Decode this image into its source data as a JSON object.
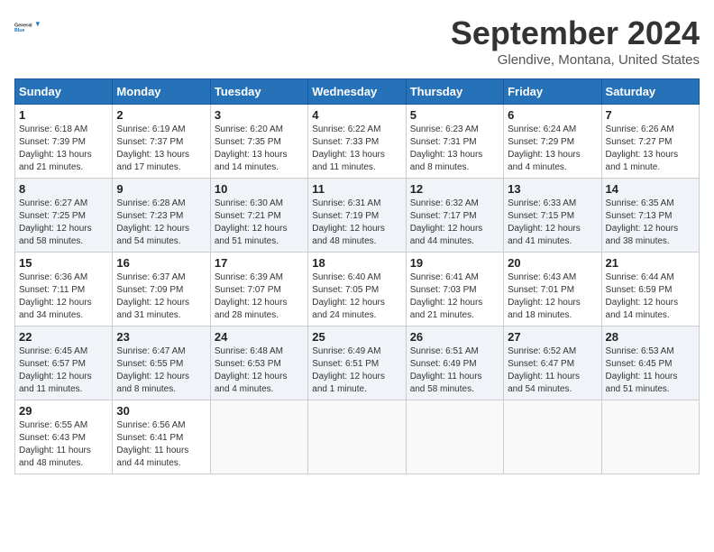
{
  "logo": {
    "line1": "General",
    "line2": "Blue"
  },
  "title": "September 2024",
  "subtitle": "Glendive, Montana, United States",
  "weekdays": [
    "Sunday",
    "Monday",
    "Tuesday",
    "Wednesday",
    "Thursday",
    "Friday",
    "Saturday"
  ],
  "weeks": [
    [
      {
        "day": "1",
        "info": "Sunrise: 6:18 AM\nSunset: 7:39 PM\nDaylight: 13 hours\nand 21 minutes."
      },
      {
        "day": "2",
        "info": "Sunrise: 6:19 AM\nSunset: 7:37 PM\nDaylight: 13 hours\nand 17 minutes."
      },
      {
        "day": "3",
        "info": "Sunrise: 6:20 AM\nSunset: 7:35 PM\nDaylight: 13 hours\nand 14 minutes."
      },
      {
        "day": "4",
        "info": "Sunrise: 6:22 AM\nSunset: 7:33 PM\nDaylight: 13 hours\nand 11 minutes."
      },
      {
        "day": "5",
        "info": "Sunrise: 6:23 AM\nSunset: 7:31 PM\nDaylight: 13 hours\nand 8 minutes."
      },
      {
        "day": "6",
        "info": "Sunrise: 6:24 AM\nSunset: 7:29 PM\nDaylight: 13 hours\nand 4 minutes."
      },
      {
        "day": "7",
        "info": "Sunrise: 6:26 AM\nSunset: 7:27 PM\nDaylight: 13 hours\nand 1 minute."
      }
    ],
    [
      {
        "day": "8",
        "info": "Sunrise: 6:27 AM\nSunset: 7:25 PM\nDaylight: 12 hours\nand 58 minutes."
      },
      {
        "day": "9",
        "info": "Sunrise: 6:28 AM\nSunset: 7:23 PM\nDaylight: 12 hours\nand 54 minutes."
      },
      {
        "day": "10",
        "info": "Sunrise: 6:30 AM\nSunset: 7:21 PM\nDaylight: 12 hours\nand 51 minutes."
      },
      {
        "day": "11",
        "info": "Sunrise: 6:31 AM\nSunset: 7:19 PM\nDaylight: 12 hours\nand 48 minutes."
      },
      {
        "day": "12",
        "info": "Sunrise: 6:32 AM\nSunset: 7:17 PM\nDaylight: 12 hours\nand 44 minutes."
      },
      {
        "day": "13",
        "info": "Sunrise: 6:33 AM\nSunset: 7:15 PM\nDaylight: 12 hours\nand 41 minutes."
      },
      {
        "day": "14",
        "info": "Sunrise: 6:35 AM\nSunset: 7:13 PM\nDaylight: 12 hours\nand 38 minutes."
      }
    ],
    [
      {
        "day": "15",
        "info": "Sunrise: 6:36 AM\nSunset: 7:11 PM\nDaylight: 12 hours\nand 34 minutes."
      },
      {
        "day": "16",
        "info": "Sunrise: 6:37 AM\nSunset: 7:09 PM\nDaylight: 12 hours\nand 31 minutes."
      },
      {
        "day": "17",
        "info": "Sunrise: 6:39 AM\nSunset: 7:07 PM\nDaylight: 12 hours\nand 28 minutes."
      },
      {
        "day": "18",
        "info": "Sunrise: 6:40 AM\nSunset: 7:05 PM\nDaylight: 12 hours\nand 24 minutes."
      },
      {
        "day": "19",
        "info": "Sunrise: 6:41 AM\nSunset: 7:03 PM\nDaylight: 12 hours\nand 21 minutes."
      },
      {
        "day": "20",
        "info": "Sunrise: 6:43 AM\nSunset: 7:01 PM\nDaylight: 12 hours\nand 18 minutes."
      },
      {
        "day": "21",
        "info": "Sunrise: 6:44 AM\nSunset: 6:59 PM\nDaylight: 12 hours\nand 14 minutes."
      }
    ],
    [
      {
        "day": "22",
        "info": "Sunrise: 6:45 AM\nSunset: 6:57 PM\nDaylight: 12 hours\nand 11 minutes."
      },
      {
        "day": "23",
        "info": "Sunrise: 6:47 AM\nSunset: 6:55 PM\nDaylight: 12 hours\nand 8 minutes."
      },
      {
        "day": "24",
        "info": "Sunrise: 6:48 AM\nSunset: 6:53 PM\nDaylight: 12 hours\nand 4 minutes."
      },
      {
        "day": "25",
        "info": "Sunrise: 6:49 AM\nSunset: 6:51 PM\nDaylight: 12 hours\nand 1 minute."
      },
      {
        "day": "26",
        "info": "Sunrise: 6:51 AM\nSunset: 6:49 PM\nDaylight: 11 hours\nand 58 minutes."
      },
      {
        "day": "27",
        "info": "Sunrise: 6:52 AM\nSunset: 6:47 PM\nDaylight: 11 hours\nand 54 minutes."
      },
      {
        "day": "28",
        "info": "Sunrise: 6:53 AM\nSunset: 6:45 PM\nDaylight: 11 hours\nand 51 minutes."
      }
    ],
    [
      {
        "day": "29",
        "info": "Sunrise: 6:55 AM\nSunset: 6:43 PM\nDaylight: 11 hours\nand 48 minutes."
      },
      {
        "day": "30",
        "info": "Sunrise: 6:56 AM\nSunset: 6:41 PM\nDaylight: 11 hours\nand 44 minutes."
      },
      null,
      null,
      null,
      null,
      null
    ]
  ]
}
